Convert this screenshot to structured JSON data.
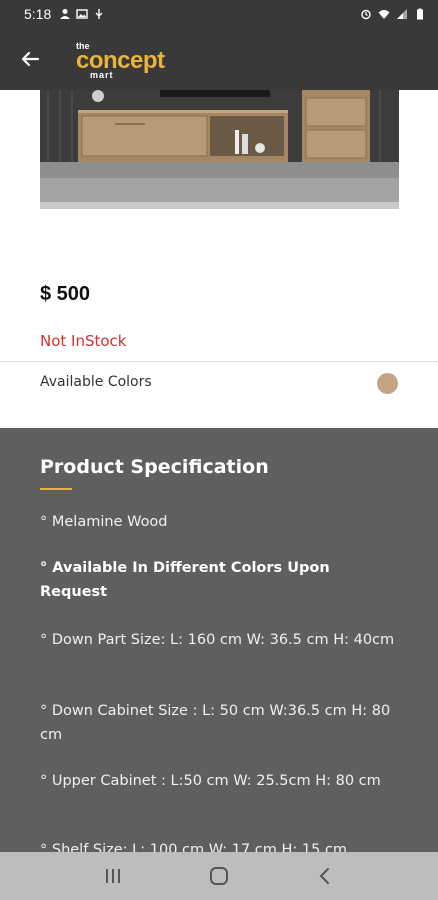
{
  "status_bar": {
    "time": "5:18",
    "left_icons": [
      "person-icon",
      "image-icon",
      "usb-icon"
    ],
    "right_icons": [
      "alarm-icon",
      "wifi-icon",
      "signal-icon",
      "battery-icon"
    ]
  },
  "app_bar": {
    "logo_the": "the",
    "logo_main": "concept",
    "logo_sub": "mart",
    "background": "#393939",
    "brand_color": "#e8b43a"
  },
  "product": {
    "price": "$ 500",
    "stock_status": "Not InStock",
    "colors_label": "Available Colors",
    "color_swatches": [
      "#c4a484"
    ]
  },
  "specification": {
    "title": "Product Specification",
    "items": [
      {
        "text": "° Melamine Wood",
        "bold": false
      },
      {
        "text": "° Available In Different Colors Upon Request",
        "bold": true
      },
      {
        "text": "° Down Part Size: L: 160 cm  W: 36.5 cm  H: 40cm",
        "bold": false
      },
      {
        "text": "° Down Cabinet Size : L: 50 cm W:36.5 cm H: 80 cm",
        "bold": false
      },
      {
        "text": "° Upper Cabinet : L:50 cm W: 25.5cm H: 80 cm",
        "bold": false
      },
      {
        "text": "° Shelf Size: L: 100 cm  W: 17 cm  H: 15 cm",
        "bold": false
      }
    ]
  },
  "nav_bar": {
    "buttons": [
      "recent-apps-icon",
      "home-icon",
      "back-icon"
    ]
  }
}
